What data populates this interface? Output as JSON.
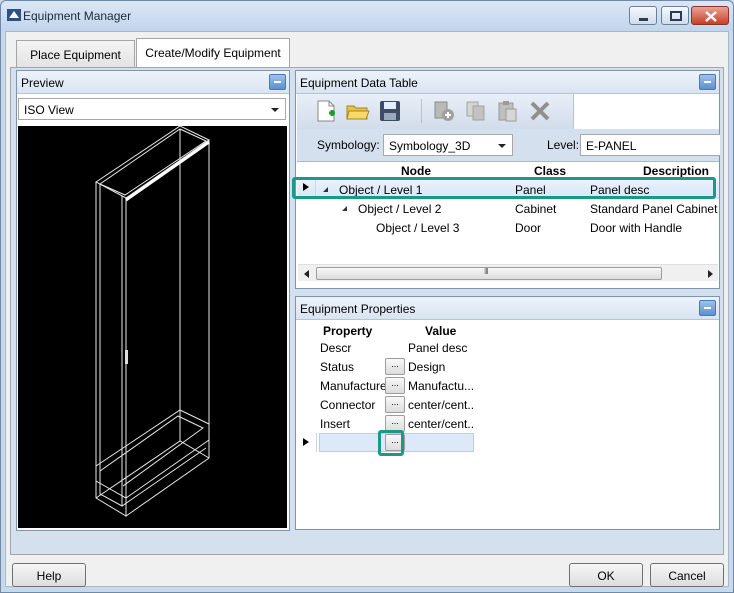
{
  "window": {
    "title": "Equipment Manager"
  },
  "tabs": [
    {
      "label": "Place Equipment"
    },
    {
      "label": "Create/Modify Equipment"
    }
  ],
  "preview": {
    "title": "Preview",
    "view_combo": "ISO View"
  },
  "data_table": {
    "title": "Equipment Data Table",
    "toolbar_icons": [
      "new-document-icon",
      "open-folder-icon",
      "save-icon",
      "add-equipment-icon",
      "copy-icon",
      "paste-icon",
      "delete-icon"
    ],
    "symbology_label": "Symbology:",
    "symbology_value": "Symbology_3D",
    "level_label": "Level:",
    "level_value": "E-PANEL",
    "columns": [
      "Node",
      "Class",
      "Description"
    ],
    "rows": [
      {
        "node": "Object / Level 1",
        "class": "Panel",
        "description": "Panel desc"
      },
      {
        "node": "Object / Level 2",
        "class": "Cabinet",
        "description": "Standard Panel Cabinet"
      },
      {
        "node": "Object / Level 3",
        "class": "Door",
        "description": "Door with Handle"
      }
    ]
  },
  "properties": {
    "title": "Equipment Properties",
    "columns": [
      "Property",
      "Value"
    ],
    "rows": [
      {
        "name": "Descr",
        "value": "Panel desc",
        "has_button": false
      },
      {
        "name": "Status",
        "value": "Design",
        "has_button": true
      },
      {
        "name": "Manufacture",
        "value": "Manufactu...",
        "has_button": true
      },
      {
        "name": "Connector",
        "value": "center/cent...",
        "has_button": true
      },
      {
        "name": "Insert",
        "value": "center/cent...",
        "has_button": true
      }
    ],
    "ellipsis": "..."
  },
  "buttons": {
    "help": "Help",
    "ok": "OK",
    "cancel": "Cancel"
  },
  "colors": {
    "highlight": "#1a9a86",
    "accent": "#5c8fd1"
  }
}
